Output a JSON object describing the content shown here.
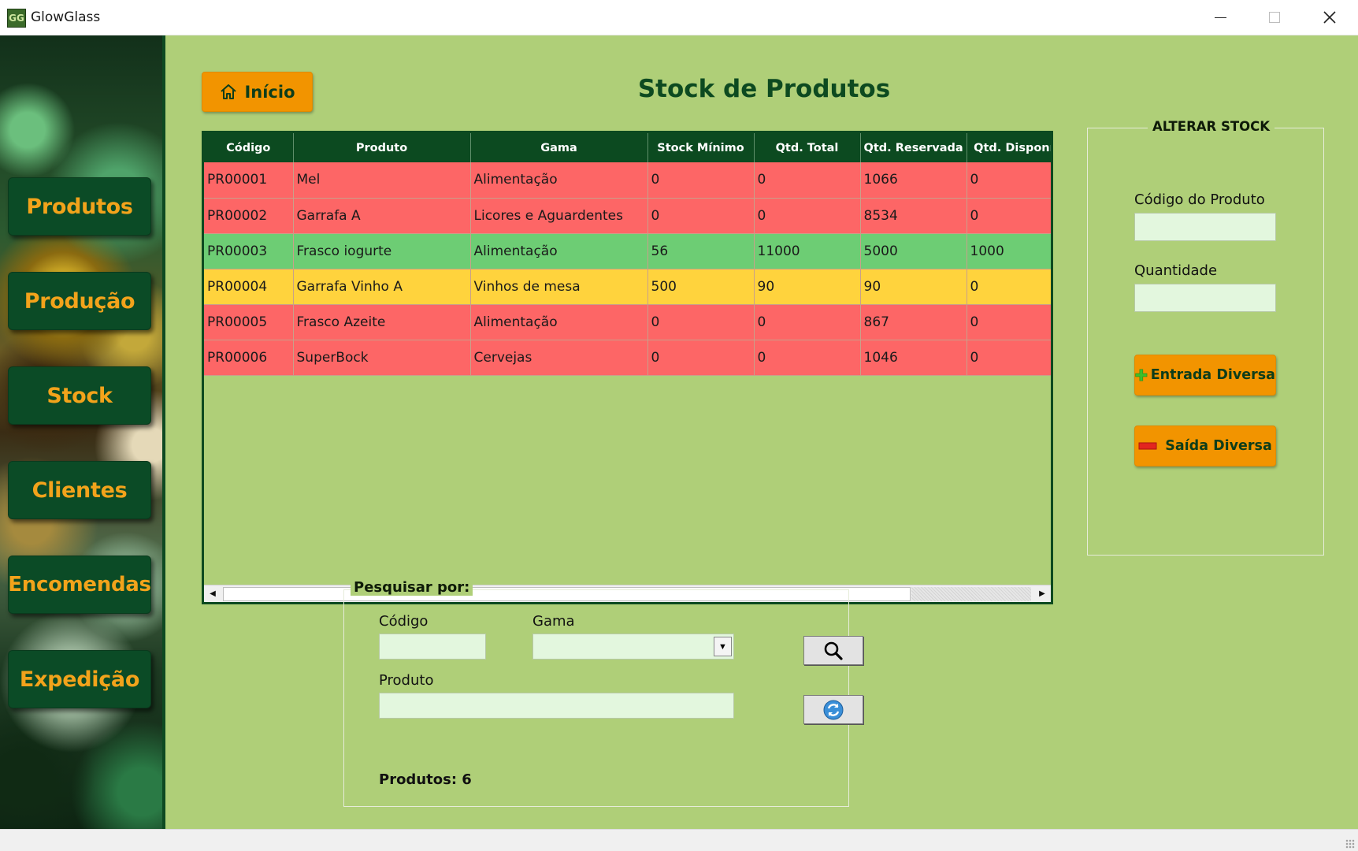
{
  "window": {
    "icon_text": "GG",
    "title": "GlowGlass"
  },
  "sidebar": {
    "items": [
      {
        "label": "Produtos"
      },
      {
        "label": "Produção"
      },
      {
        "label": "Stock"
      },
      {
        "label": "Clientes"
      },
      {
        "label": "Encomendas"
      },
      {
        "label": "Expedição"
      }
    ]
  },
  "header": {
    "home_label": "Início",
    "page_title": "Stock de Produtos"
  },
  "table": {
    "columns": [
      "Código",
      "Produto",
      "Gama",
      "Stock Mínimo",
      "Qtd. Total",
      "Qtd. Reservada",
      "Qtd. Disponível"
    ],
    "rows": [
      {
        "status": "red",
        "cells": [
          "PR00001",
          "Mel",
          "Alimentação",
          "0",
          "0",
          "1066",
          "0"
        ]
      },
      {
        "status": "red",
        "cells": [
          "PR00002",
          "Garrafa A",
          "Licores e Aguardentes",
          "0",
          "0",
          "8534",
          "0"
        ]
      },
      {
        "status": "green",
        "cells": [
          "PR00003",
          "Frasco iogurte",
          "Alimentação",
          "56",
          "11000",
          "5000",
          "1000"
        ]
      },
      {
        "status": "yellow",
        "cells": [
          "PR00004",
          "Garrafa Vinho A",
          "Vinhos de mesa",
          "500",
          "90",
          "90",
          "0"
        ]
      },
      {
        "status": "red",
        "cells": [
          "PR00005",
          "Frasco Azeite",
          "Alimentação",
          "0",
          "0",
          "867",
          "0"
        ]
      },
      {
        "status": "red",
        "cells": [
          "PR00006",
          "SuperBock",
          "Cervejas",
          "0",
          "0",
          "1046",
          "0"
        ]
      }
    ],
    "status_colors": {
      "red": "#fd6666",
      "green": "#6dcd74",
      "yellow": "#ffd33d"
    }
  },
  "search": {
    "legend": "Pesquisar por:",
    "codigo_label": "Código",
    "codigo_value": "",
    "gama_label": "Gama",
    "gama_value": "",
    "produto_label": "Produto",
    "produto_value": "",
    "search_icon": "search-icon",
    "refresh_icon": "refresh-icon",
    "count_label": "Produtos: 6"
  },
  "stock_panel": {
    "legend": "ALTERAR STOCK",
    "codigo_label": "Código do Produto",
    "codigo_value": "",
    "quantidade_label": "Quantidade",
    "quantidade_value": "",
    "entrada_label": "Entrada Diversa",
    "saida_label": "Saída Diversa"
  },
  "colors": {
    "background": "#afcf78",
    "accent": "#f29400",
    "dark_green": "#0c4a20"
  }
}
